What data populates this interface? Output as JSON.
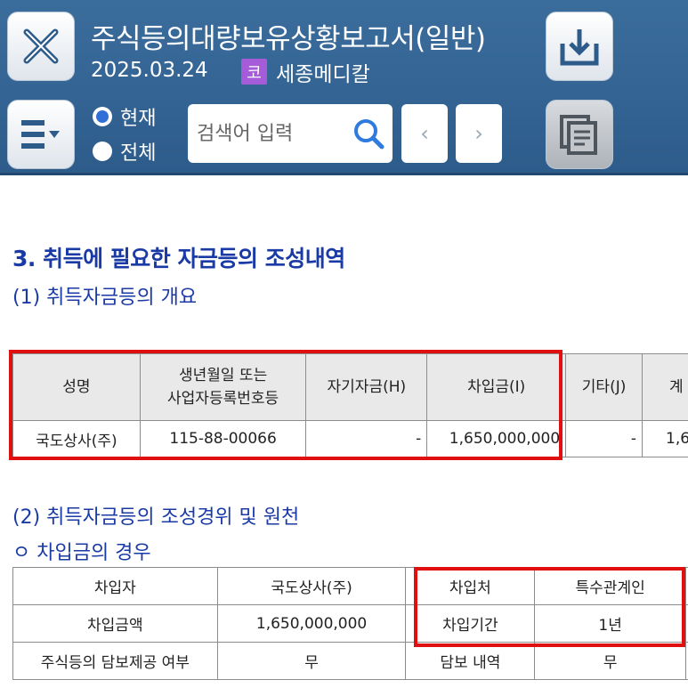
{
  "header": {
    "title": "주식등의대량보유상황보고서(일반)",
    "date": "2025.03.24",
    "market_badge": "코",
    "company": "세종메디칼",
    "radio_current": "현재",
    "radio_all": "전체",
    "search_placeholder": "검색어 입력",
    "prev": "‹",
    "next": "›",
    "icons": [
      "close-icon",
      "menu-icon",
      "download-icon",
      "documents-icon",
      "search-icon"
    ],
    "accent_color": "#2d5c8b"
  },
  "section": {
    "heading": "3. 취득에 필요한 자금등의 조성내역",
    "sub1": "(1) 취득자금등의 개요",
    "sub2": "(2) 취득자금등의 조성경위 및 원천",
    "sub3": "ㅇ 차입금의 경우"
  },
  "table1": {
    "headers": [
      "성명",
      "생년월일 또는\n사업자등록번호등",
      "자기자금(H)",
      "차입금(I)",
      "기타(J)",
      "계"
    ],
    "row": [
      "국도상사(주)",
      "115-88-00066",
      "-",
      "1,650,000,000",
      "-",
      "1,6"
    ]
  },
  "table2": {
    "rows": [
      [
        "차입자",
        "국도상사(주)",
        "차입처",
        "특수관계인"
      ],
      [
        "차입금액",
        "1,650,000,000",
        "차입기간",
        "1년"
      ],
      [
        "주식등의 담보제공 여부",
        "무",
        "담보 내역",
        "무"
      ]
    ]
  }
}
